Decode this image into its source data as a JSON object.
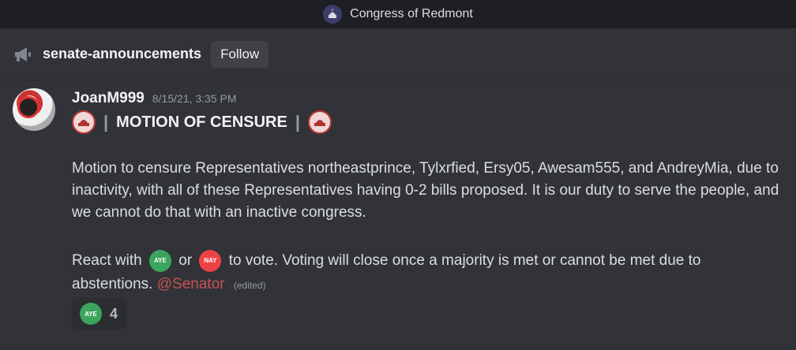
{
  "server": {
    "name": "Congress of Redmont"
  },
  "channel": {
    "name": "senate-announcements",
    "follow_label": "Follow"
  },
  "message": {
    "author": "JoanM999",
    "timestamp": "8/15/21, 3:35 PM",
    "title_separator": "|",
    "title": "MOTION OF CENSURE",
    "paragraph1": "Motion to censure Representatives northeastprince, Tylxrfied, Ersy05, Awesam555, and AndreyMia, due to inactivity, with all of these Representatives having 0-2 bills proposed.  It is our duty to serve the people, and we cannot do that with an inactive congress.",
    "vote_prefix": "React with",
    "vote_or": "or",
    "vote_suffix": "to vote. Voting will close once a majority is met or cannot be met due to abstentions.",
    "aye_label": "AYE",
    "nay_label": "NAY",
    "mention": "@Senator",
    "edited": "(edited)"
  },
  "reaction": {
    "emoji_label": "AYE",
    "count": "4"
  },
  "colors": {
    "background": "#313338",
    "titlebar": "#1e1f22",
    "aye": "#3ba55d",
    "nay": "#ed4245",
    "mention": "#c75151"
  }
}
